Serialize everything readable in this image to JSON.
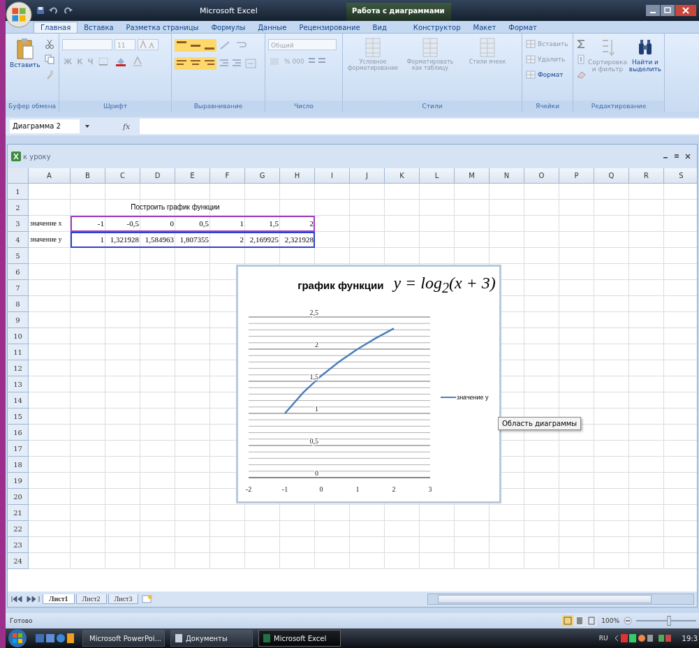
{
  "window": {
    "title": "Microsoft Excel",
    "context_group": "Работа с диаграммами"
  },
  "ribbon_tabs": [
    {
      "label": "Главная",
      "selected": true
    },
    {
      "label": "Вставка",
      "selected": false
    },
    {
      "label": "Разметка страницы",
      "selected": false
    },
    {
      "label": "Формулы",
      "selected": false
    },
    {
      "label": "Данные",
      "selected": false
    },
    {
      "label": "Рецензирование",
      "selected": false
    },
    {
      "label": "Вид",
      "selected": false
    }
  ],
  "context_tabs": [
    {
      "label": "Конструктор",
      "selected": false
    },
    {
      "label": "Макет",
      "selected": false
    },
    {
      "label": "Формат",
      "selected": false
    }
  ],
  "ribbon": {
    "clipboard": {
      "label": "Буфер обмена",
      "paste": {
        "label": "Вставить",
        "disabled": false
      }
    },
    "font": {
      "label": "Шрифт",
      "font_size": "11",
      "styles": [
        "Ж",
        "К",
        "Ч"
      ]
    },
    "alignment": {
      "label": "Выравнивание"
    },
    "number": {
      "label": "Число",
      "format": "Общий",
      "symbols": [
        "%",
        "000"
      ]
    },
    "styles": {
      "label": "Стили",
      "commands": [
        {
          "label": "Условное форматирование",
          "disabled": true
        },
        {
          "label": "Форматировать как таблицу",
          "disabled": true
        },
        {
          "label": "Стили ячеек",
          "disabled": true
        }
      ]
    },
    "cells": {
      "label": "Ячейки",
      "commands": [
        {
          "label": "Вставить",
          "disabled": true
        },
        {
          "label": "Удалить",
          "disabled": true
        },
        {
          "label": "Формат",
          "disabled": false
        }
      ]
    },
    "editing": {
      "label": "Редактирование",
      "commands": [
        {
          "label": "Сортировка и фильтр",
          "disabled": true
        },
        {
          "label": "Найти и выделить",
          "disabled": false
        }
      ]
    }
  },
  "formula_bar": {
    "name_box": "Диаграмма 2",
    "function_label": "fx"
  },
  "workbook": {
    "title": "к уроку",
    "columns": [
      "A",
      "B",
      "C",
      "D",
      "E",
      "F",
      "G",
      "H",
      "I",
      "J",
      "K",
      "L",
      "M",
      "N",
      "O",
      "P",
      "Q",
      "R",
      "S"
    ],
    "rows": [
      {
        "number": "1"
      },
      {
        "number": "2",
        "heading": "Построить график функции"
      },
      {
        "number": "3",
        "label": "значение x",
        "values": [
          "-1",
          "-0,5",
          "0",
          "0,5",
          "1",
          "1,5",
          "2"
        ]
      },
      {
        "number": "4",
        "label": "значение y",
        "values": [
          "1",
          "1,321928",
          "1,584963",
          "1,807355",
          "2",
          "2,169925",
          "2,321928"
        ]
      },
      {
        "number": "5"
      },
      {
        "number": "6"
      },
      {
        "number": "7"
      },
      {
        "number": "8"
      },
      {
        "number": "9"
      },
      {
        "number": "10"
      },
      {
        "number": "11"
      },
      {
        "number": "12"
      },
      {
        "number": "13"
      },
      {
        "number": "14"
      },
      {
        "number": "15"
      },
      {
        "number": "16"
      },
      {
        "number": "17"
      },
      {
        "number": "18"
      },
      {
        "number": "19"
      },
      {
        "number": "20"
      },
      {
        "number": "21"
      },
      {
        "number": "22"
      },
      {
        "number": "23"
      },
      {
        "number": "24"
      }
    ],
    "chart": {
      "title": "график функции",
      "formula": "y = log$_{2}$(x + 3)",
      "tooltip": "Область диаграммы",
      "chart_data": {
        "type": "line",
        "x": [
          -1,
          -0.5,
          0,
          0.5,
          1,
          1.5,
          2
        ],
        "series": [
          {
            "name": "значение y",
            "color": "#4a7ebb",
            "values": [
              1,
              1.321928,
              1.584963,
              1.807355,
              2,
              2.169925,
              2.321928
            ]
          }
        ],
        "xlim": [
          -2,
          3
        ],
        "ylim": [
          0,
          2.5
        ],
        "grid": true,
        "xticks": [
          -2,
          -1,
          0,
          1,
          2,
          3
        ],
        "yticks": [
          {
            "value": 0,
            "label": "0"
          },
          {
            "value": 0.5,
            "label": "0,5"
          },
          {
            "value": 1,
            "label": "1"
          },
          {
            "value": 1.5,
            "label": "1,5"
          },
          {
            "value": 2,
            "label": "2"
          },
          {
            "value": 2.5,
            "label": "2,5"
          }
        ]
      }
    },
    "sheet_tabs": [
      {
        "label": "Лист1",
        "selected": true
      },
      {
        "label": "Лист2",
        "selected": false
      },
      {
        "label": "Лист3",
        "selected": false
      }
    ]
  },
  "status_bar": {
    "text": "Готово",
    "zoom": "100%",
    "zoom_slider": {
      "level": 0.55
    }
  },
  "taskbar": {
    "items": [
      {
        "label": "Microsoft PowerPoi...",
        "selected": false
      },
      {
        "label": "Документы",
        "selected": false
      },
      {
        "label": "Microsoft Excel",
        "selected": true
      }
    ],
    "language": "RU",
    "clock": "19:3"
  }
}
